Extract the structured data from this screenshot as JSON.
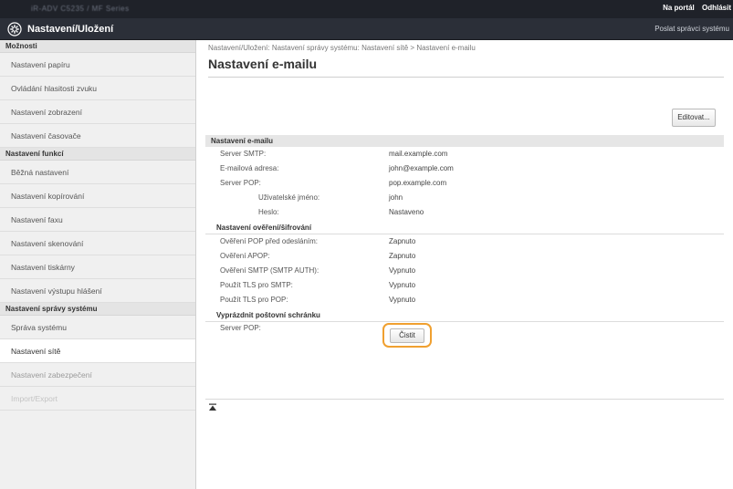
{
  "topbar": {
    "device_name": "iR-ADV C5235 / MF Series",
    "portal_label": "Na portál",
    "logout_label": "Odhlásit"
  },
  "titlebar": {
    "icon": "gear-icon",
    "title": "Nastavení/Uložení",
    "sys_manager_label": "Poslat správci systému"
  },
  "sidebar": {
    "groups": [
      {
        "header": "Možnosti",
        "items": [
          {
            "label": "Nastavení papíru"
          },
          {
            "label": "Ovládání hlasitosti zvuku"
          },
          {
            "label": "Nastavení zobrazení"
          },
          {
            "label": "Nastavení časovače"
          }
        ]
      },
      {
        "header": "Nastavení funkcí",
        "items": [
          {
            "label": "Běžná nastavení"
          },
          {
            "label": "Nastavení kopírování"
          },
          {
            "label": "Nastavení faxu"
          },
          {
            "label": "Nastavení skenování"
          },
          {
            "label": "Nastavení tiskárny"
          },
          {
            "label": "Nastavení výstupu hlášení"
          }
        ]
      },
      {
        "header": "Nastavení správy systému",
        "items": [
          {
            "label": "Správa systému"
          },
          {
            "label": "Nastavení sítě"
          },
          {
            "label": "Nastavení zabezpečení"
          },
          {
            "label": "Import/Export"
          }
        ]
      }
    ]
  },
  "main": {
    "breadcrumb": "Nastavení/Uložení: Nastavení správy systému: Nastavení sítě > Nastavení e-mailu",
    "page_title": "Nastavení e-mailu",
    "edit_label": "Editovat...",
    "section_title": "Nastavení e-mailu",
    "rows": [
      {
        "label": "Server SMTP:",
        "value": "mail.example.com"
      },
      {
        "label": "E-mailová adresa:",
        "value": "john@example.com"
      },
      {
        "label": "Server POP:",
        "value": "pop.example.com"
      },
      {
        "label": "Uživatelské jméno:",
        "value": "john"
      },
      {
        "label": "Heslo:",
        "value": "Nastaveno"
      }
    ],
    "auth_title": "Nastavení ověření/šifrování",
    "auth_rows": [
      {
        "label": "Ověření POP před odesláním:",
        "value": "Zapnuto"
      },
      {
        "label": "Ověření APOP:",
        "value": "Zapnuto"
      },
      {
        "label": "Ověření SMTP (SMTP AUTH):",
        "value": "Vypnuto"
      },
      {
        "label": "Použít TLS pro SMTP:",
        "value": "Vypnuto"
      },
      {
        "label": "Použít TLS pro POP:",
        "value": "Vypnuto"
      }
    ],
    "mailbox_title": "Vyprázdnit poštovní schránku",
    "mailbox_label": "Server POP:",
    "clear_label": "Čistit"
  },
  "colors": {
    "accent": "#f0a030",
    "topbar": "#1f2229",
    "titlebar": "#2b2f38"
  }
}
